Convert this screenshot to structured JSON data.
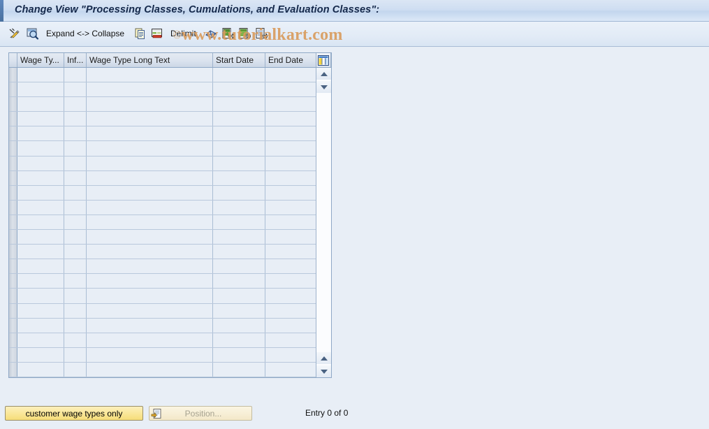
{
  "window": {
    "title": "Change View \"Processing Classes, Cumulations, and Evaluation Classes\":"
  },
  "toolbar": {
    "items": [
      {
        "name": "change-entry-icon",
        "icon": "pencil-icon",
        "label": "",
        "type": "icon"
      },
      {
        "name": "display-entry-icon",
        "icon": "magnifier-icon",
        "label": "",
        "type": "icon"
      },
      {
        "name": "expand-collapse-button",
        "icon": "",
        "label": "Expand <-> Collapse",
        "type": "text"
      },
      {
        "name": "copy-as-icon",
        "icon": "copy-pages-icon",
        "label": "",
        "type": "icon"
      },
      {
        "name": "delete-row-icon",
        "icon": "delete-row-icon",
        "label": "",
        "type": "icon"
      },
      {
        "name": "delimit-button",
        "icon": "",
        "label": "Delimit",
        "type": "text"
      },
      {
        "name": "undo-icon",
        "icon": "undo-arrow-icon",
        "label": "",
        "type": "icon"
      },
      {
        "name": "expand-entry-icon",
        "icon": "document-arrow-green-icon",
        "label": "",
        "type": "icon"
      },
      {
        "name": "select-entry-icon",
        "icon": "document-arrow-green2-icon",
        "label": "",
        "type": "icon"
      },
      {
        "name": "detail-entry-icon",
        "icon": "document-arrow-lines-icon",
        "label": "",
        "type": "icon"
      }
    ]
  },
  "watermark": {
    "copyright": "©",
    "text": "www.tutorialkart.com"
  },
  "table": {
    "columns": [
      {
        "name": "wage-type",
        "label": "Wage Ty..."
      },
      {
        "name": "infotype",
        "label": "Inf..."
      },
      {
        "name": "wage-type-long-text",
        "label": "Wage Type Long Text"
      },
      {
        "name": "start-date",
        "label": "Start Date"
      },
      {
        "name": "end-date",
        "label": "End Date"
      }
    ],
    "rows": [],
    "empty_row_count": 21,
    "config_icon": "column-settings-icon",
    "scroll": {
      "up_icon": "scroll-up-arrow-icon",
      "down_icon": "scroll-down-arrow-icon"
    }
  },
  "footer": {
    "customer_wage_types_label": "customer wage types only",
    "position_label": "Position...",
    "position_icon": "position-jump-icon",
    "entry_status": "Entry 0 of 0"
  },
  "colors": {
    "background": "#e8eef6",
    "title_accent": "#48709f",
    "watermark": "#d99c5e",
    "button_yellow": "#f9e79a"
  }
}
